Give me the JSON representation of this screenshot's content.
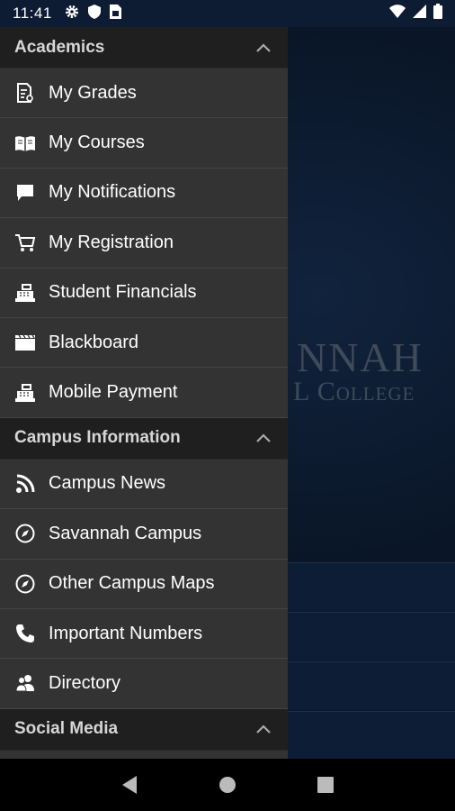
{
  "status_bar": {
    "time": "11:41",
    "left_icons": [
      "gear-icon",
      "shield-icon",
      "sim-card-icon"
    ],
    "right_icons": [
      "wifi-icon",
      "cell-signal-icon",
      "battery-icon"
    ]
  },
  "background": {
    "logo_line1": "NNAH",
    "logo_line2": "L College"
  },
  "drawer": {
    "sections": [
      {
        "title": "Academics",
        "items": [
          {
            "label": "My Grades",
            "icon": "grades-icon"
          },
          {
            "label": "My Courses",
            "icon": "book-icon"
          },
          {
            "label": "My Notifications",
            "icon": "chat-bubble-icon"
          },
          {
            "label": "My Registration",
            "icon": "cart-icon"
          },
          {
            "label": "Student Financials",
            "icon": "cash-register-icon"
          },
          {
            "label": "Blackboard",
            "icon": "clapperboard-icon"
          },
          {
            "label": "Mobile Payment",
            "icon": "cash-register-icon"
          }
        ]
      },
      {
        "title": "Campus Information",
        "items": [
          {
            "label": "Campus News",
            "icon": "rss-icon"
          },
          {
            "label": "Savannah Campus",
            "icon": "compass-icon"
          },
          {
            "label": "Other Campus Maps",
            "icon": "compass-icon"
          },
          {
            "label": "Important Numbers",
            "icon": "phone-icon"
          },
          {
            "label": "Directory",
            "icon": "people-icon"
          }
        ]
      },
      {
        "title": "Social Media",
        "items": []
      }
    ]
  },
  "nav_bar": [
    "back-icon",
    "home-icon",
    "recents-icon"
  ],
  "colors": {
    "drawer_bg": "#333333",
    "section_header_bg": "#1f1f1f",
    "status_bar_bg": "#0d1b33",
    "background_app": "#0a1628"
  }
}
